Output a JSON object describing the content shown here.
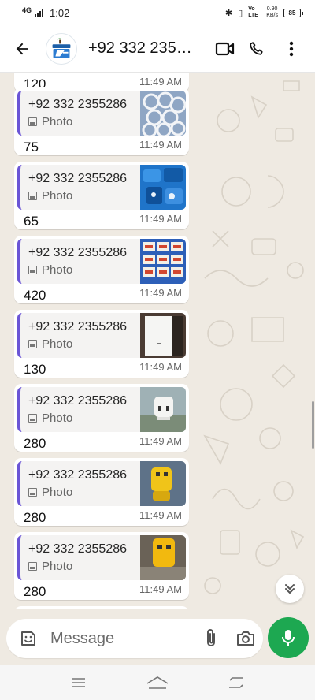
{
  "status_bar": {
    "network": "4G",
    "time": "1:02",
    "volte": "Vo LTE",
    "speed_value": "0.90",
    "speed_unit": "KB/s",
    "battery": "85"
  },
  "header": {
    "back_icon": "arrow-left-icon",
    "title": "+92 332 235…",
    "video_icon": "video-camera-icon",
    "call_icon": "phone-icon",
    "menu_icon": "more-vert-icon"
  },
  "chat": {
    "partial_top_text": "120",
    "partial_top_time": "11:49 AM",
    "messages": [
      {
        "quoted_name": "+92 332 2355286",
        "quoted_type": "Photo",
        "text": "75",
        "time": "11:49 AM",
        "thumb_color": "#8fa6c4"
      },
      {
        "quoted_name": "+92 332 2355286",
        "quoted_type": "Photo",
        "text": "65",
        "time": "11:49 AM",
        "thumb_color": "#1f74c9"
      },
      {
        "quoted_name": "+92 332 2355286",
        "quoted_type": "Photo",
        "text": "420",
        "time": "11:49 AM",
        "thumb_color": "#2d5fb8"
      },
      {
        "quoted_name": "+92 332 2355286",
        "quoted_type": "Photo",
        "text": "130",
        "time": "11:49 AM",
        "thumb_color": "#4a3b33"
      },
      {
        "quoted_name": "+92 332 2355286",
        "quoted_type": "Photo",
        "text": "280",
        "time": "11:49 AM",
        "thumb_color": "#9fb1b5"
      },
      {
        "quoted_name": "+92 332 2355286",
        "quoted_type": "Photo",
        "text": "280",
        "time": "11:49 AM",
        "thumb_color": "#5e7288"
      },
      {
        "quoted_name": "+92 332 2355286",
        "quoted_type": "Photo",
        "text": "280",
        "time": "11:49 AM",
        "thumb_color": "#6a6257"
      }
    ]
  },
  "composer": {
    "placeholder": "Message",
    "emoji_icon": "sticker-icon",
    "attach_icon": "paperclip-icon",
    "camera_icon": "camera-icon",
    "mic_icon": "microphone-icon"
  },
  "nav": {
    "menu_icon": "recent-apps-icon",
    "home_icon": "home-icon",
    "back_icon": "back-icon"
  },
  "colors": {
    "accent_green": "#1da851",
    "quote_bar": "#6b55d6",
    "chat_bg": "#efeae2"
  }
}
